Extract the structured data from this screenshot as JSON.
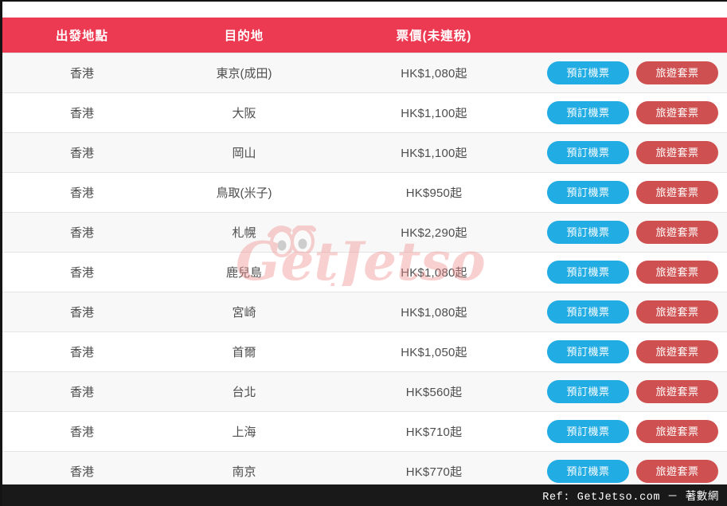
{
  "table": {
    "headers": {
      "origin": "出發地點",
      "destination": "目的地",
      "fare": "票價(未連稅)",
      "actions": ""
    },
    "rows": [
      {
        "origin": "香港",
        "destination": "東京(成田)",
        "fare": "HK$1,080起",
        "book_label": "預訂機票",
        "package_label": "旅遊套票"
      },
      {
        "origin": "香港",
        "destination": "大阪",
        "fare": "HK$1,100起",
        "book_label": "預訂機票",
        "package_label": "旅遊套票"
      },
      {
        "origin": "香港",
        "destination": "岡山",
        "fare": "HK$1,100起",
        "book_label": "預訂機票",
        "package_label": "旅遊套票"
      },
      {
        "origin": "香港",
        "destination": "鳥取(米子)",
        "fare": "HK$950起",
        "book_label": "預訂機票",
        "package_label": "旅遊套票"
      },
      {
        "origin": "香港",
        "destination": "札幌",
        "fare": "HK$2,290起",
        "book_label": "預訂機票",
        "package_label": "旅遊套票"
      },
      {
        "origin": "香港",
        "destination": "鹿兒島",
        "fare": "HK$1,080起",
        "book_label": "預訂機票",
        "package_label": "旅遊套票"
      },
      {
        "origin": "香港",
        "destination": "宮崎",
        "fare": "HK$1,080起",
        "book_label": "預訂機票",
        "package_label": "旅遊套票"
      },
      {
        "origin": "香港",
        "destination": "首爾",
        "fare": "HK$1,050起",
        "book_label": "預訂機票",
        "package_label": "旅遊套票"
      },
      {
        "origin": "香港",
        "destination": "台北",
        "fare": "HK$560起",
        "book_label": "預訂機票",
        "package_label": "旅遊套票"
      },
      {
        "origin": "香港",
        "destination": "上海",
        "fare": "HK$710起",
        "book_label": "預訂機票",
        "package_label": "旅遊套票"
      },
      {
        "origin": "香港",
        "destination": "南京",
        "fare": "HK$770起",
        "book_label": "預訂機票",
        "package_label": "旅遊套票"
      }
    ]
  },
  "watermark": {
    "text": "GetJetso",
    "color": "#f08b8b"
  },
  "footer": {
    "text": "Ref: GetJetso.com － 著數網"
  },
  "colors": {
    "header_red": "#ec3a52",
    "book_button_blue": "#21ace3",
    "package_button_red": "#cf5050",
    "row_alt": "#f8f8f8",
    "footer_black": "#191919"
  }
}
